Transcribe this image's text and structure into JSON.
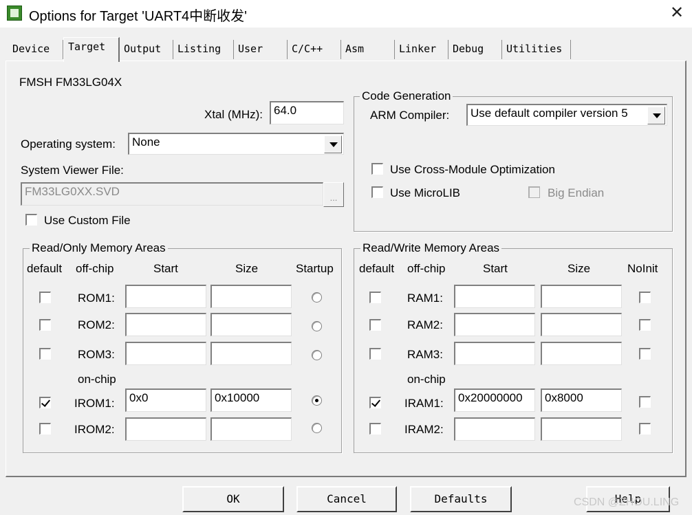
{
  "window": {
    "title": "Options for Target 'UART4中断收发'",
    "close_symbol": "✕"
  },
  "tabs": [
    "Device",
    "Target",
    "Output",
    "Listing",
    "User",
    "C/C++",
    "Asm",
    "Linker",
    "Debug",
    "Utilities"
  ],
  "active_tab": "Target",
  "device": {
    "name": "FMSH FM33LG04X"
  },
  "xtal": {
    "label": "Xtal (MHz):",
    "value": "64.0"
  },
  "os": {
    "label": "Operating system:",
    "value": "None"
  },
  "svd": {
    "label": "System Viewer File:",
    "value": "FM33LG0XX.SVD",
    "browse": "...",
    "use_custom_label": "Use Custom File",
    "use_custom_checked": false
  },
  "codegen": {
    "legend": "Code Generation",
    "compiler_label": "ARM Compiler:",
    "compiler_value": "Use default compiler version 5",
    "cross_module_label": "Use Cross-Module Optimization",
    "microlib_label": "Use MicroLIB",
    "big_endian_label": "Big Endian"
  },
  "ro": {
    "legend": "Read/Only Memory Areas",
    "headers": {
      "default": "default",
      "offchip": "off-chip",
      "start": "Start",
      "size": "Size",
      "startup": "Startup"
    },
    "onchip_label": "on-chip",
    "rows": [
      {
        "name": "ROM1:",
        "start": "",
        "size": "",
        "default": false,
        "startup": false
      },
      {
        "name": "ROM2:",
        "start": "",
        "size": "",
        "default": false,
        "startup": false
      },
      {
        "name": "ROM3:",
        "start": "",
        "size": "",
        "default": false,
        "startup": false
      },
      {
        "name": "IROM1:",
        "start": "0x0",
        "size": "0x10000",
        "default": true,
        "startup": true
      },
      {
        "name": "IROM2:",
        "start": "",
        "size": "",
        "default": false,
        "startup": false
      }
    ]
  },
  "rw": {
    "legend": "Read/Write Memory Areas",
    "headers": {
      "default": "default",
      "offchip": "off-chip",
      "start": "Start",
      "size": "Size",
      "noinit": "NoInit"
    },
    "onchip_label": "on-chip",
    "rows": [
      {
        "name": "RAM1:",
        "start": "",
        "size": "",
        "default": false,
        "noinit": false
      },
      {
        "name": "RAM2:",
        "start": "",
        "size": "",
        "default": false,
        "noinit": false
      },
      {
        "name": "RAM3:",
        "start": "",
        "size": "",
        "default": false,
        "noinit": false
      },
      {
        "name": "IRAM1:",
        "start": "0x20000000",
        "size": "0x8000",
        "default": true,
        "noinit": false
      },
      {
        "name": "IRAM2:",
        "start": "",
        "size": "",
        "default": false,
        "noinit": false
      }
    ]
  },
  "buttons": {
    "ok": "OK",
    "cancel": "Cancel",
    "defaults": "Defaults",
    "help": "Help"
  },
  "watermark": "CSDN @ZHOU.LING"
}
